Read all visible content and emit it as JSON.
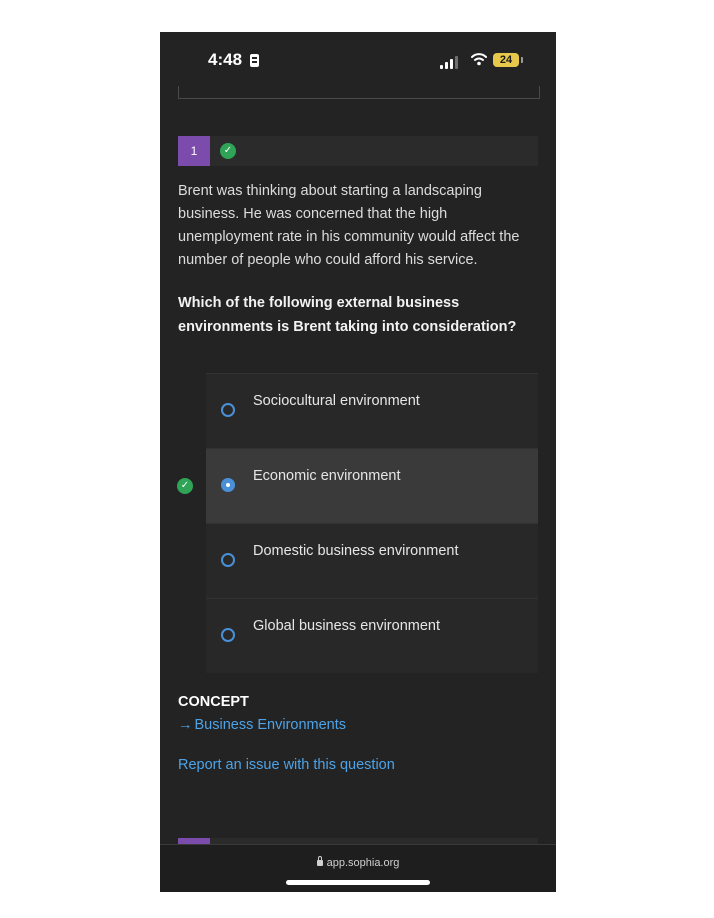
{
  "status_bar": {
    "time": "4:48",
    "battery": "24"
  },
  "question": {
    "number": "1",
    "stem": "Brent was thinking about starting a landscaping business. He was concerned that the high unemployment rate in his community would affect the number of people who could afford his service.",
    "prompt": "Which of the following external business environments is Brent taking into consideration?",
    "status": "correct",
    "options": [
      {
        "label": "Sociocultural environment",
        "selected": false
      },
      {
        "label": "Economic environment",
        "selected": true
      },
      {
        "label": "Domestic business environment",
        "selected": false
      },
      {
        "label": "Global business environment",
        "selected": false
      }
    ]
  },
  "concept": {
    "heading": "CONCEPT",
    "link_label": "Business Environments"
  },
  "report_label": "Report an issue with this question",
  "browser": {
    "url": "app.sophia.org"
  },
  "colors": {
    "accent_blue": "#4da3e8",
    "question_badge": "#7b4cab",
    "correct_green": "#2fa457",
    "battery": "#e7c84b"
  }
}
